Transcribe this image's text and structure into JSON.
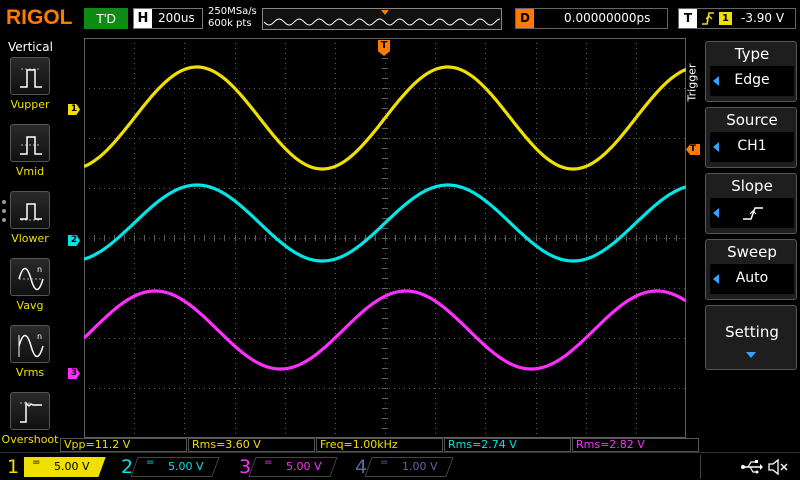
{
  "top": {
    "logo": "RIGOL",
    "run_state": "T'D",
    "horizontal_letter": "H",
    "timebase": "200us",
    "sample_rate": "250MSa/s",
    "memory_points": "600k pts",
    "delay_letter": "D",
    "delay_value": "0.00000000ps",
    "trigger_letter": "T",
    "trigger_channel": "1",
    "trigger_level": "-3.90 V"
  },
  "left_menu": {
    "title": "Vertical",
    "items": [
      {
        "label": "Vupper",
        "icon": "vupper-icon"
      },
      {
        "label": "Vmid",
        "icon": "vmid-icon"
      },
      {
        "label": "Vlower",
        "icon": "vlower-icon"
      },
      {
        "label": "Vavg",
        "icon": "vavg-icon"
      },
      {
        "label": "Vrms",
        "icon": "vrms-icon"
      },
      {
        "label": "Overshoot",
        "icon": "overshoot-icon"
      }
    ]
  },
  "markers": {
    "trigger_pos": "T",
    "trigger_level": "T",
    "ch1": "1",
    "ch2": "2",
    "ch3": "3"
  },
  "right_menu": {
    "side_label": "Trigger",
    "type": {
      "title": "Type",
      "value": "Edge"
    },
    "source": {
      "title": "Source",
      "value": "CH1"
    },
    "slope": {
      "title": "Slope",
      "value": "rising-edge-icon"
    },
    "sweep": {
      "title": "Sweep",
      "value": "Auto"
    },
    "setting": {
      "title": "Setting"
    }
  },
  "measurements": [
    {
      "text": "Vpp=11.2 V",
      "color": "#f0e000"
    },
    {
      "text": "Rms=3.60 V",
      "color": "#f0e000"
    },
    {
      "text": "Freq=1.00kHz",
      "color": "#f0e000"
    },
    {
      "text": "Rms=2.74 V",
      "color": "#00e5e5"
    },
    {
      "text": "Rms=2.82 V",
      "color": "#ff30ff"
    }
  ],
  "channels": [
    {
      "num": "1",
      "coupling": "=",
      "scale": "5.00 V",
      "color": "#f0e000",
      "active": true
    },
    {
      "num": "2",
      "coupling": "=",
      "scale": "5.00 V",
      "color": "#00e5e5",
      "active": false
    },
    {
      "num": "3",
      "coupling": "=",
      "scale": "5.00 V",
      "color": "#ff30ff",
      "active": false
    },
    {
      "num": "4",
      "coupling": "=",
      "scale": "1.00 V",
      "color": "#5a6aa0",
      "active": false
    }
  ],
  "colors": {
    "ch1": "#f0e000",
    "ch2": "#00e5e5",
    "ch3": "#ff30ff",
    "trigger": "#ff7a00",
    "grid": "#606060",
    "accent": "#3aa0ff"
  },
  "chart_data": {
    "type": "line",
    "x_unit": "s",
    "xlim": [
      -0.0012,
      0.0012
    ],
    "ylim": [
      -20,
      20
    ],
    "series": [
      {
        "name": "CH1",
        "color": "#f0e000",
        "kind": "sine",
        "frequency": 1000,
        "amplitude": 5.1,
        "offset": 12.0,
        "phase_deg": 0
      },
      {
        "name": "CH2",
        "color": "#00e5e5",
        "kind": "sine",
        "frequency": 1000,
        "amplitude": 3.8,
        "offset": 1.5,
        "phase_deg": 0
      },
      {
        "name": "CH3",
        "color": "#ff30ff",
        "kind": "sine",
        "frequency": 1000,
        "amplitude": 3.9,
        "offset": -9.2,
        "phase_deg": 60
      }
    ]
  }
}
